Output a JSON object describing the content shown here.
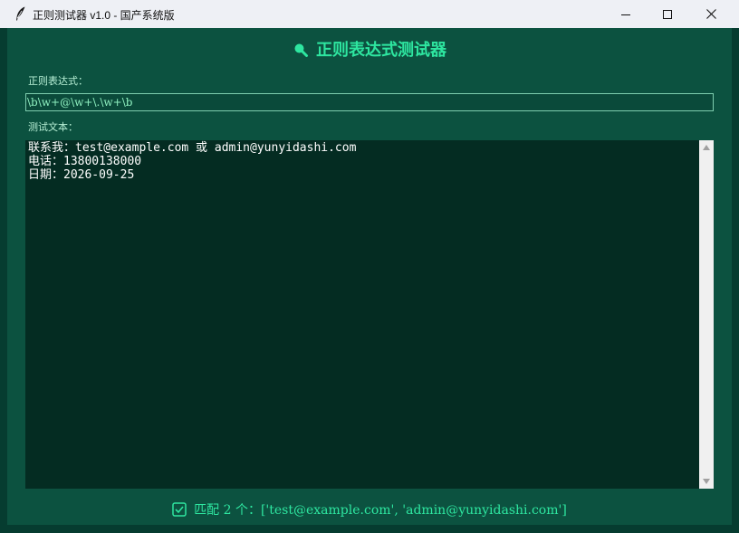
{
  "window": {
    "title": "正则测试器 v1.0 - 国产系统版",
    "icon": "feather-icon",
    "controls": {
      "minimize": "minimize-icon",
      "maximize": "maximize-icon",
      "close": "close-icon"
    }
  },
  "header": {
    "icon": "search-icon",
    "title": "正则表达式测试器"
  },
  "regex": {
    "label": "正则表达式：",
    "value": "\\b\\w+@\\w+\\.\\w+\\b"
  },
  "test_text": {
    "label": "测试文本：",
    "content": "联系我：test@example.com 或 admin@yunyidashi.com\n电话：13800138000\n日期：2026-09-25"
  },
  "status": {
    "icon": "check-icon",
    "text": "匹配 2 个：['test@example.com', 'admin@yunyidashi.com']"
  },
  "colors": {
    "accent": "#2ee6a0",
    "background": "#0c5240",
    "text_area_bg": "#042c22"
  }
}
